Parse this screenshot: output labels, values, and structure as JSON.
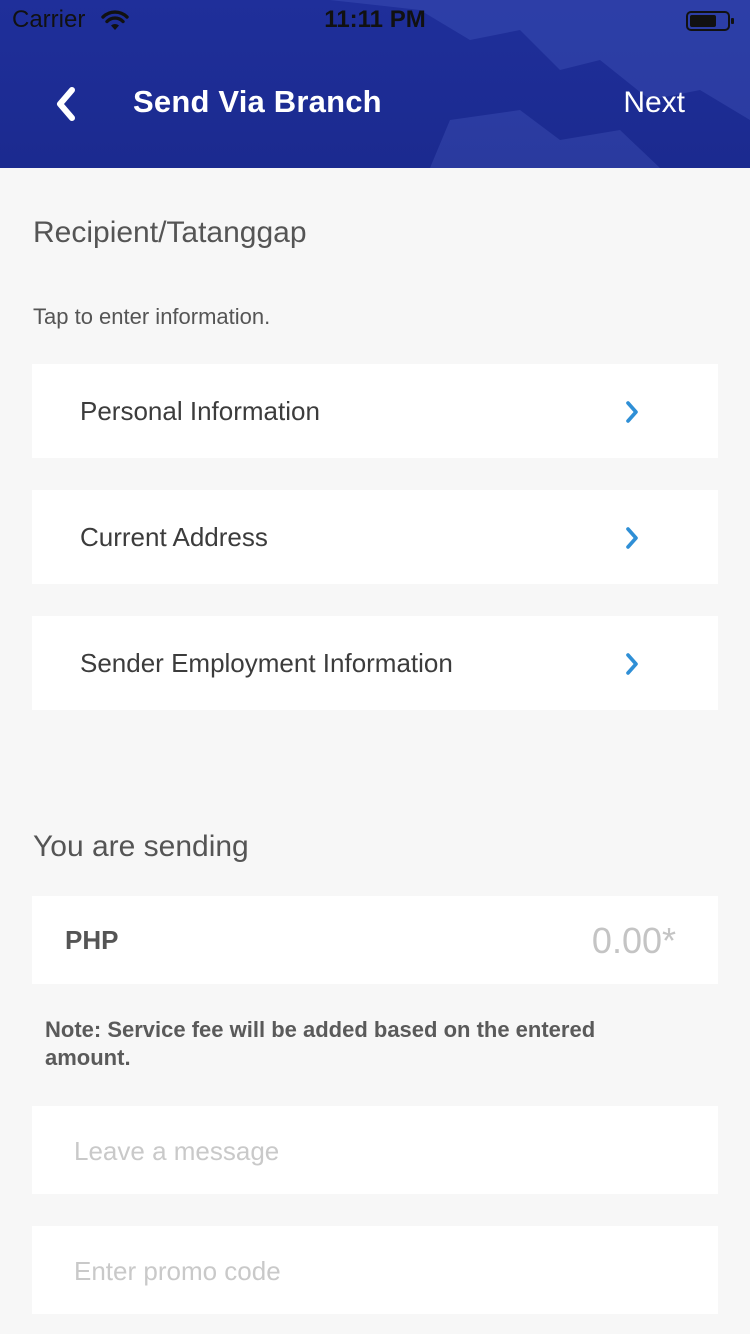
{
  "status_bar": {
    "carrier": "Carrier",
    "time": "11:11 PM"
  },
  "nav": {
    "back_icon": "chevron-left-icon",
    "title": "Send Via Branch",
    "next_label": "Next"
  },
  "recipient": {
    "heading": "Recipient/Tatanggap",
    "hint": "Tap to enter information.",
    "items": [
      {
        "label": "Personal Information"
      },
      {
        "label": "Current Address"
      },
      {
        "label": "Sender Employment Information"
      }
    ]
  },
  "sending": {
    "heading": "You are sending",
    "currency": "PHP",
    "amount_placeholder": "0.00*",
    "amount_value": "",
    "note": "Note: Service fee will be added based on the entered amount."
  },
  "message": {
    "placeholder": "Leave a message",
    "value": ""
  },
  "promo": {
    "placeholder": "Enter promo code",
    "value": ""
  },
  "colors": {
    "header_bg": "#1f2f9a",
    "chevron": "#2f8fd6",
    "page_bg": "#f7f7f7"
  }
}
